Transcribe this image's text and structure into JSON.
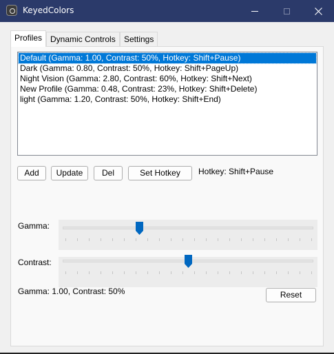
{
  "window": {
    "title": "KeyedColors"
  },
  "tabs": [
    {
      "label": "Profiles"
    },
    {
      "label": "Dynamic Controls"
    },
    {
      "label": "Settings"
    }
  ],
  "profiles": {
    "items": [
      "Default (Gamma: 1.00, Contrast: 50%, Hotkey: Shift+Pause)",
      "Dark (Gamma: 0.80, Contrast: 50%, Hotkey: Shift+PageUp)",
      "Night Vision (Gamma: 2.80, Contrast: 60%, Hotkey: Shift+Next)",
      "New Profile (Gamma: 0.48, Contrast: 23%, Hotkey: Shift+Delete)",
      "light (Gamma: 1.20, Contrast: 50%, Hotkey: Shift+End)"
    ],
    "selected_index": 0
  },
  "buttons": {
    "add": "Add",
    "update": "Update",
    "del": "Del",
    "set_hotkey": "Set Hotkey",
    "reset": "Reset"
  },
  "hotkey_label": "Hotkey: Shift+Pause",
  "gamma": {
    "label": "Gamma:",
    "level": 0.3
  },
  "contrast": {
    "label": "Contrast:",
    "level": 0.5
  },
  "status": "Gamma: 1.00, Contrast: 50%",
  "colors": {
    "titlebar": "#2b3a6a",
    "selection": "#0078d7",
    "thumb": "#0067c0"
  }
}
